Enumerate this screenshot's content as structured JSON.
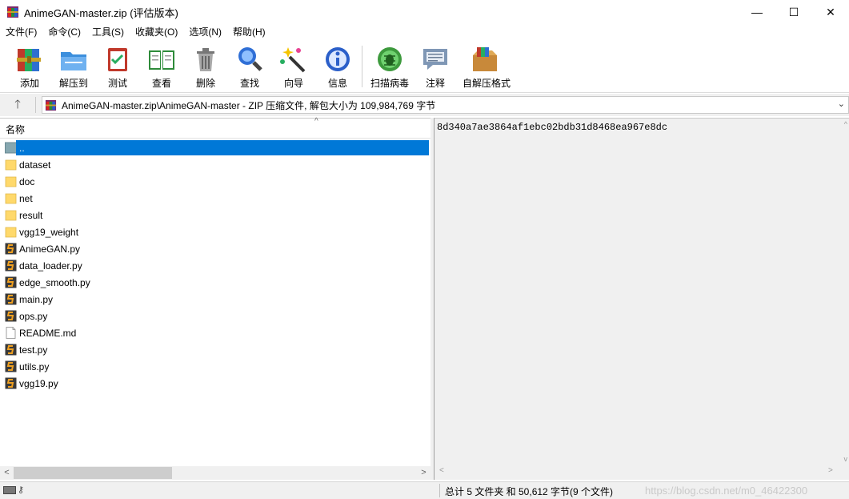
{
  "window": {
    "title": "AnimeGAN-master.zip (评估版本)",
    "minimize": "—",
    "maximize": "☐",
    "close": "✕"
  },
  "menu": [
    "文件(F)",
    "命令(C)",
    "工具(S)",
    "收藏夹(O)",
    "选项(N)",
    "帮助(H)"
  ],
  "toolbar": {
    "add": "添加",
    "extract": "解压到",
    "test": "测试",
    "view": "查看",
    "delete": "删除",
    "find": "查找",
    "wizard": "向导",
    "info": "信息",
    "scan": "扫描病毒",
    "comment": "注释",
    "sfx": "自解压格式"
  },
  "address": {
    "path": "AnimeGAN-master.zip\\AnimeGAN-master - ZIP 压缩文件, 解包大小为 109,984,769 字节",
    "up": "🡑",
    "dropdown": "⌄"
  },
  "columns": {
    "name": "名称",
    "sort": "^"
  },
  "files": [
    {
      "name": "..",
      "type": "parent"
    },
    {
      "name": "dataset",
      "type": "folder"
    },
    {
      "name": "doc",
      "type": "folder"
    },
    {
      "name": "net",
      "type": "folder"
    },
    {
      "name": "result",
      "type": "folder"
    },
    {
      "name": "vgg19_weight",
      "type": "folder"
    },
    {
      "name": "AnimeGAN.py",
      "type": "python"
    },
    {
      "name": "data_loader.py",
      "type": "python"
    },
    {
      "name": "edge_smooth.py",
      "type": "python"
    },
    {
      "name": "main.py",
      "type": "python"
    },
    {
      "name": "ops.py",
      "type": "python"
    },
    {
      "name": "README.md",
      "type": "document"
    },
    {
      "name": "test.py",
      "type": "python"
    },
    {
      "name": "utils.py",
      "type": "python"
    },
    {
      "name": "vgg19.py",
      "type": "python"
    }
  ],
  "selected_index": 0,
  "comment_panel": {
    "text": "8d340a7ae3864af1ebc02bdb31d8468ea967e8dc"
  },
  "status": {
    "summary": "总计 5 文件夹 和 50,612 字节(9 个文件)",
    "watermark": "https://blog.csdn.net/m0_46422300"
  },
  "colors": {
    "selection": "#0078d7",
    "folder": "#ffd96b",
    "python": "#f0a020"
  }
}
